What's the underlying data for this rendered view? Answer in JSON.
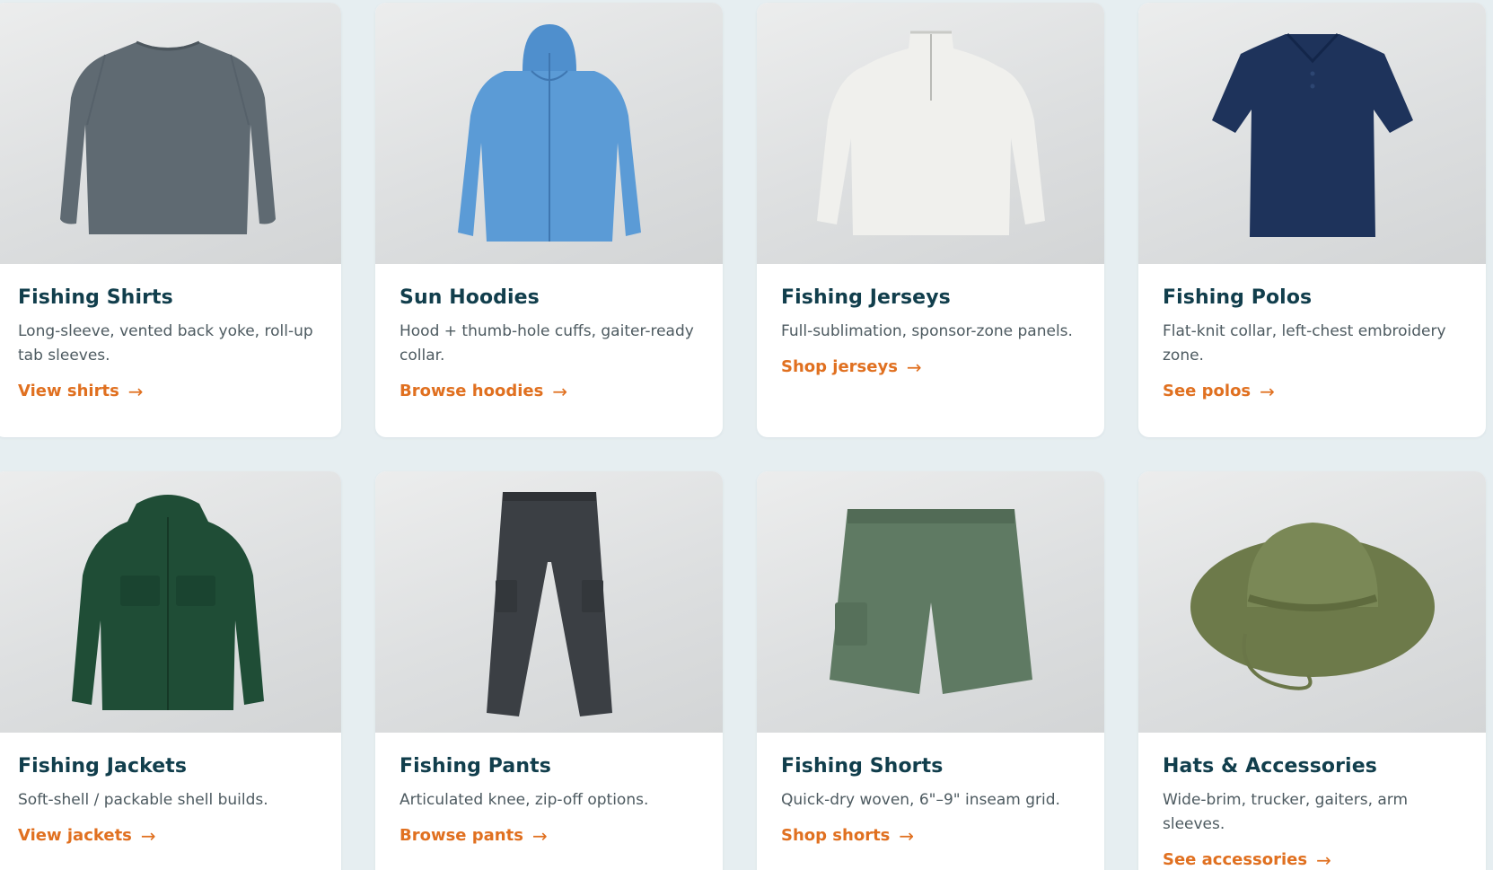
{
  "products": [
    {
      "title": "Fishing Shirts",
      "description": "Long-sleeve, vented back yoke, roll-up tab sleeves.",
      "link": "View shirts",
      "image": "gray-long-sleeve-shirt"
    },
    {
      "title": "Sun Hoodies",
      "description": "Hood + thumb-hole cuffs, gaiter-ready collar.",
      "link": "Browse hoodies",
      "image": "blue-zip-hoodie"
    },
    {
      "title": "Fishing Jerseys",
      "description": "Full-sublimation, sponsor-zone panels.",
      "link": "Shop jerseys",
      "image": "white-quarter-zip-jersey"
    },
    {
      "title": "Fishing Polos",
      "description": "Flat-knit collar, left-chest embroidery zone.",
      "link": "See polos",
      "image": "navy-polo"
    },
    {
      "title": "Fishing Jackets",
      "description": "Soft-shell / packable shell builds.",
      "link": "View jackets",
      "image": "green-hooded-jacket"
    },
    {
      "title": "Fishing Pants",
      "description": "Articulated knee, zip-off options.",
      "link": "Browse pants",
      "image": "charcoal-cargo-pants"
    },
    {
      "title": "Fishing Shorts",
      "description": "Quick-dry woven, 6\"–9\" inseam grid.",
      "link": "Shop shorts",
      "image": "green-cargo-shorts"
    },
    {
      "title": "Hats & Accessories",
      "description": "Wide-brim, trucker, gaiters, arm sleeves.",
      "link": "See accessories",
      "image": "olive-bucket-hat"
    }
  ],
  "arrow_glyph": "→",
  "colors": {
    "page_background": "#e6eef1",
    "card_background": "#ffffff",
    "title": "#113e4c",
    "description": "#4d5a60",
    "link_accent": "#e07020"
  }
}
